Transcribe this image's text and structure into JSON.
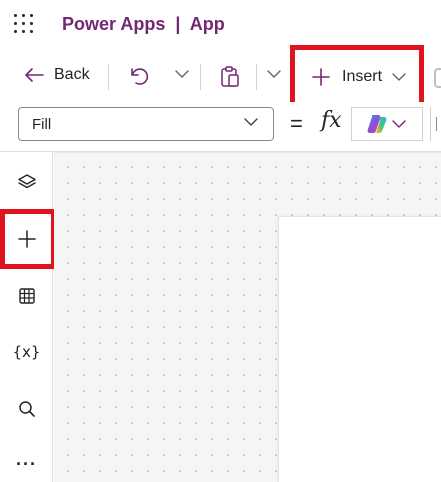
{
  "header": {
    "title": "Power Apps  |  App",
    "brand_color": "#742774"
  },
  "toolbar": {
    "back_label": "Back",
    "insert_label": "Insert",
    "icons": [
      "back-arrow-icon",
      "undo-icon",
      "paste-icon",
      "plus-icon",
      "chevron-down-icon"
    ]
  },
  "formula_bar": {
    "property": "Fill",
    "equals": "=",
    "fx": "fx"
  },
  "rail": {
    "items": [
      "layers-icon",
      "add-icon",
      "data-table-icon",
      "variables-icon",
      "search-icon",
      "more-icon"
    ],
    "variables_glyph": "{x}",
    "more_glyph": "···"
  },
  "highlight_color": "#e0141e"
}
